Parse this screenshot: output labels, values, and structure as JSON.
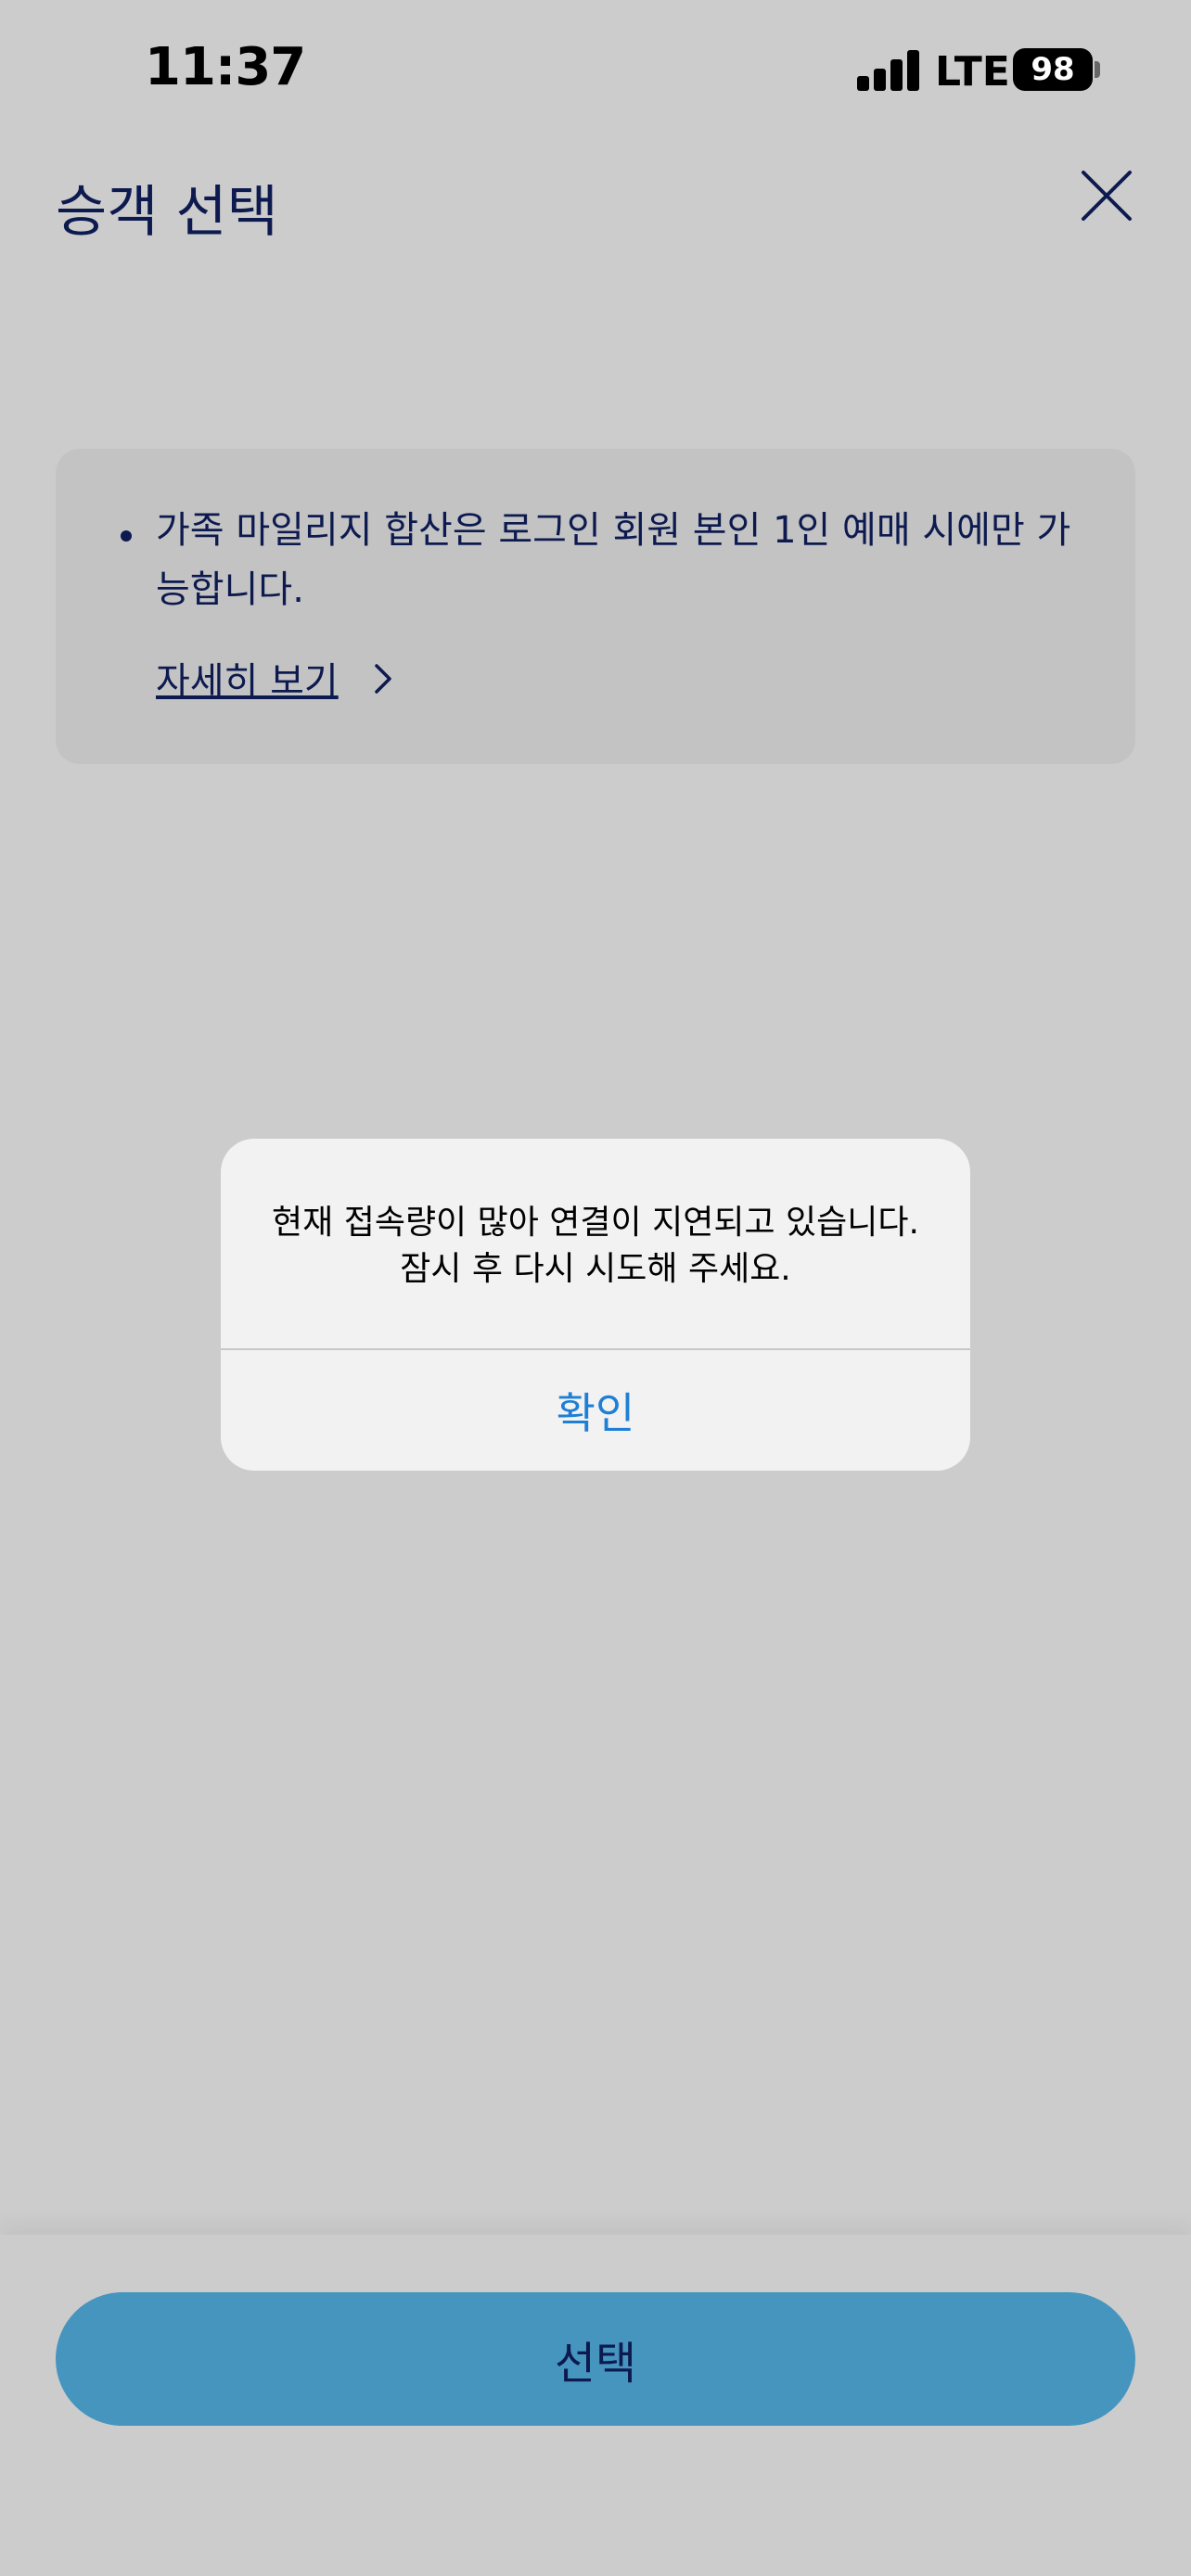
{
  "status_bar": {
    "time": "11:37",
    "network": "LTE",
    "battery": "98"
  },
  "header": {
    "title": "승객 선택",
    "close_icon": "close-icon"
  },
  "notice": {
    "text": "가족 마일리지 합산은 로그인 회원 본인 1인 예매 시에만 가능합니다.",
    "link_label": "자세히 보기",
    "link_icon": "chevron-right-icon"
  },
  "dialog": {
    "message_line1": "현재 접속량이 많아 연결이 지연되고 있습니다.",
    "message_line2": "잠시 후 다시 시도해 주세요.",
    "confirm_label": "확인"
  },
  "footer": {
    "select_label": "선택"
  },
  "colors": {
    "title_navy": "#0d1a4f",
    "dialog_accent": "#1e7fd6",
    "button_bg": "#4595bf"
  }
}
